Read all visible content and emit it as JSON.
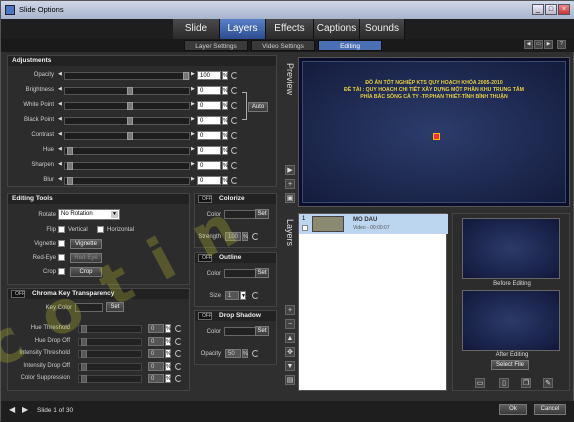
{
  "window": {
    "title": "Slide Options"
  },
  "tabs": [
    "Slide",
    "Layers",
    "Effects",
    "Captions",
    "Sounds"
  ],
  "brand": "cotin",
  "subtabs": [
    "Layer Settings",
    "Video Settings",
    "Editing"
  ],
  "adjustments": {
    "title": "Adjustments",
    "rows": [
      {
        "label": "Opacity",
        "value": "100",
        "unit": "%"
      },
      {
        "label": "Brightness",
        "value": "0",
        "unit": "%"
      },
      {
        "label": "White Point",
        "value": "0",
        "unit": "%"
      },
      {
        "label": "Black Point",
        "value": "0",
        "unit": "%"
      },
      {
        "label": "Contrast",
        "value": "0",
        "unit": "%"
      },
      {
        "label": "Hue",
        "value": "0",
        "unit": "%"
      },
      {
        "label": "Sharpen",
        "value": "0",
        "unit": "%"
      },
      {
        "label": "Blur",
        "value": "0",
        "unit": "%"
      }
    ],
    "auto_label": "Auto"
  },
  "editing_tools": {
    "title": "Editing Tools",
    "rotate_label": "Rotate",
    "rotate_value": "No Rotation",
    "flip_label": "Flip",
    "vertical_label": "Vertical",
    "horizontal_label": "Horizontal",
    "vignette_label": "Vignette",
    "vignette_button": "Vignette",
    "redeye_label": "Red-Eye",
    "redeye_button": "Red-Eye",
    "crop_label": "Crop",
    "crop_button": "Crop"
  },
  "colorize": {
    "toggle": "OFF",
    "title": "Colorize",
    "color_label": "Color",
    "set": "Set",
    "strength_label": "Strength",
    "strength_value": "100",
    "unit": "%"
  },
  "outline": {
    "toggle": "OFF",
    "title": "Outline",
    "color_label": "Color",
    "set": "Set",
    "size_label": "Size",
    "size_value": "1"
  },
  "drop_shadow": {
    "toggle": "OFF",
    "title": "Drop Shadow",
    "color_label": "Color",
    "set": "Set",
    "opacity_label": "Opacity",
    "opacity_value": "50",
    "unit": "%"
  },
  "chroma": {
    "toggle": "OFF",
    "title": "Chroma Key Transparency",
    "key_color_label": "Key Color",
    "set": "Set",
    "rows": [
      {
        "label": "Hue Threshold",
        "value": "0",
        "unit": "%"
      },
      {
        "label": "Hue Drop Off",
        "value": "0",
        "unit": "%"
      },
      {
        "label": "Intensity Threshold",
        "value": "0",
        "unit": "%"
      },
      {
        "label": "Intensity Drop Off",
        "value": "0",
        "unit": "%"
      },
      {
        "label": "Color Suppression",
        "value": "0",
        "unit": "%"
      }
    ]
  },
  "preview": {
    "label": "Preview",
    "line1": "ĐỒ ÁN TỐT NGHIỆP KTS QUY HOẠCH KHÓA 2005-2010",
    "line2": "ĐỀ TÀI : QUY HOẠCH CHI TIẾT XÂY DỰNG MỘT PHẦN KHU TRUNG TÂM",
    "line3": "PHÍA BẮC SÔNG CÀ TY -TP.PHAN THIẾT-TỈNH BÌNH THUẬN"
  },
  "layers": {
    "label": "Layers",
    "items": [
      {
        "index": "1",
        "name": "MO DAU",
        "detail": "Video - 00:00:07"
      }
    ]
  },
  "side_panel": {
    "before_label": "Before Editing",
    "after_label": "After Editing",
    "select_file": "Select File"
  },
  "footer": {
    "slide_info": "Slide 1 of 30",
    "ok": "Ok",
    "cancel": "Cancel"
  }
}
